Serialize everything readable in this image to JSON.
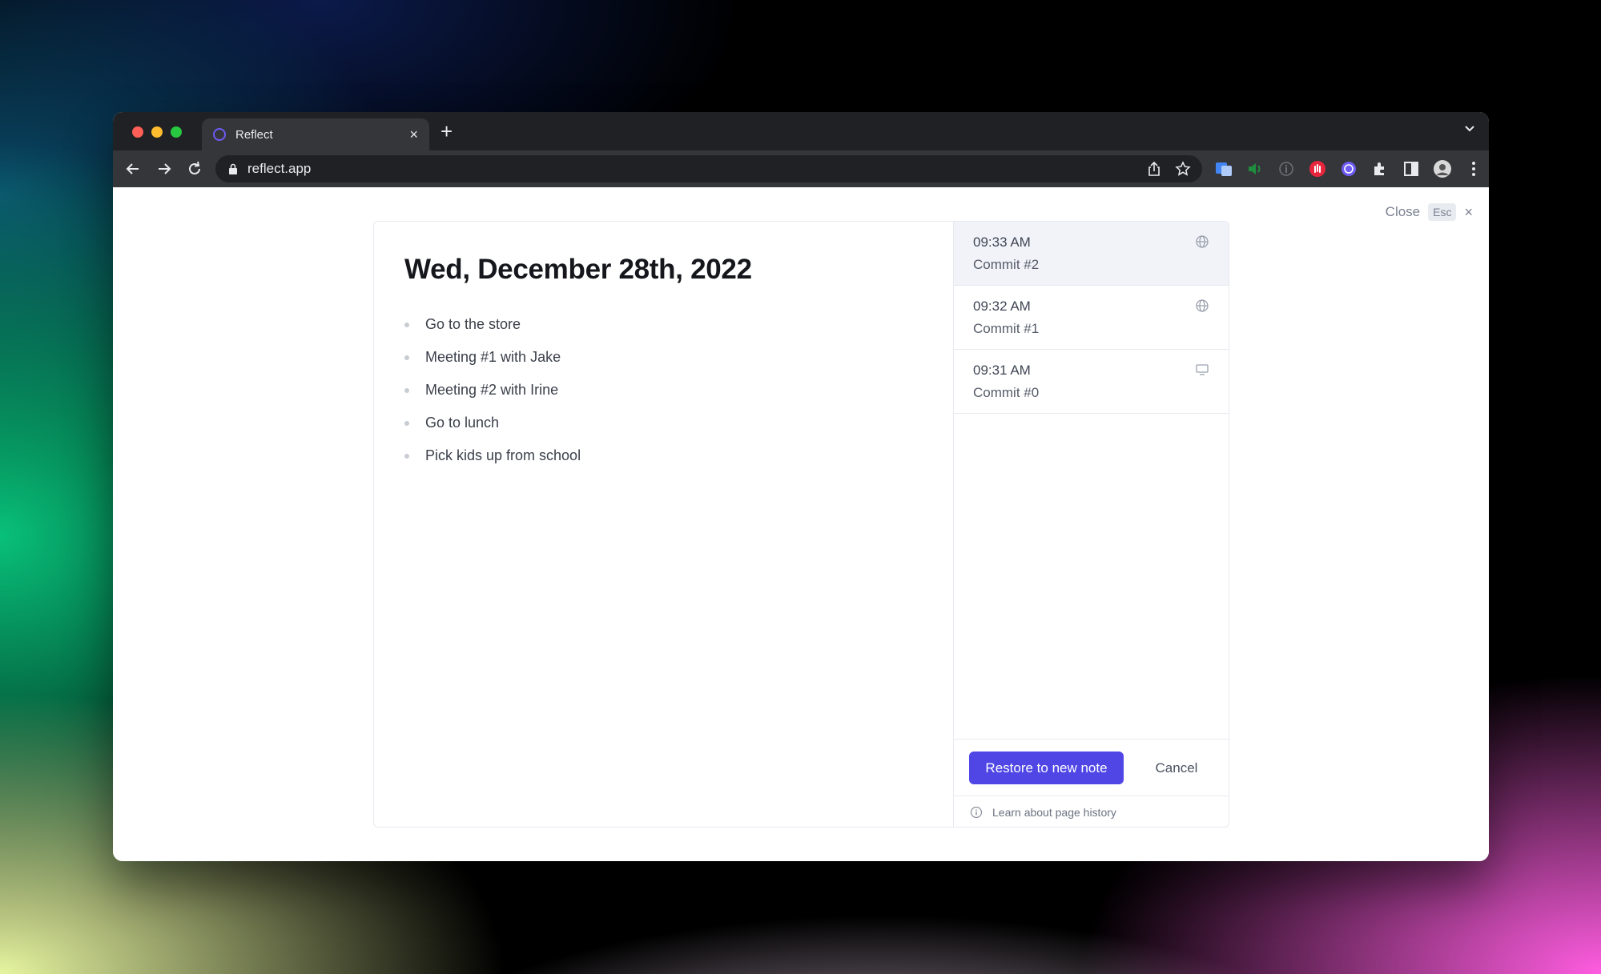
{
  "browser": {
    "tab_title": "Reflect",
    "tab_close": "×",
    "new_tab": "+",
    "url": "reflect.app"
  },
  "overlay": {
    "close_label": "Close",
    "esc_label": "Esc",
    "close_x": "×"
  },
  "note": {
    "title": "Wed, December 28th, 2022",
    "items": [
      "Go to the store",
      "Meeting #1 with Jake",
      "Meeting #2 with Irine",
      "Go to lunch",
      "Pick kids up from school"
    ]
  },
  "history": {
    "commits": [
      {
        "time": "09:33 AM",
        "name": "Commit #2",
        "icon": "globe-icon",
        "selected": true
      },
      {
        "time": "09:32 AM",
        "name": "Commit #1",
        "icon": "globe-icon",
        "selected": false
      },
      {
        "time": "09:31 AM",
        "name": "Commit #0",
        "icon": "monitor-icon",
        "selected": false
      }
    ],
    "restore_label": "Restore to new note",
    "cancel_label": "Cancel",
    "learn_label": "Learn about page history"
  },
  "colors": {
    "accent": "#4f46e5",
    "selected_row": "#f1f3f8"
  }
}
